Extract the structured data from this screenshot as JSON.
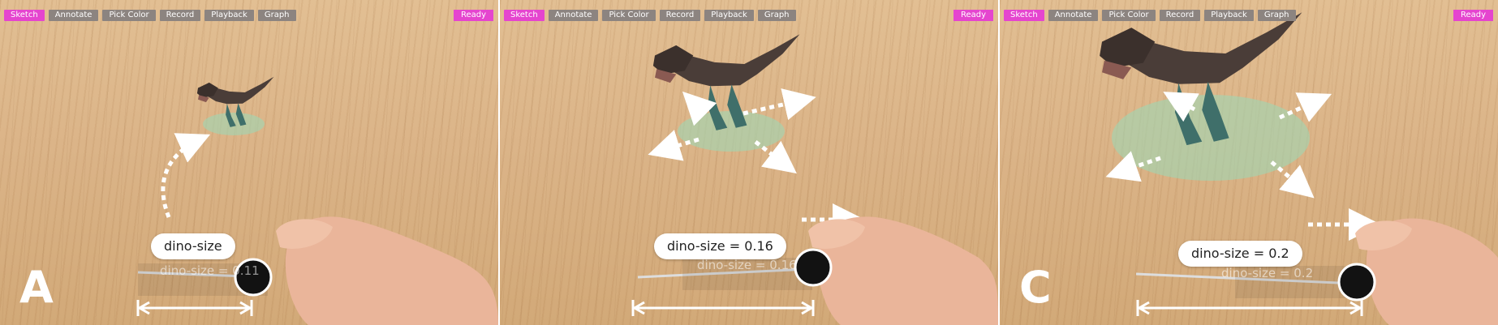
{
  "toolbar": {
    "buttons": [
      "Sketch",
      "Annotate",
      "Pick Color",
      "Record",
      "Playback",
      "Graph"
    ],
    "active": "Sketch",
    "status": "Ready"
  },
  "colors": {
    "accent": "#e545cf",
    "button": "#8c8480",
    "table": "#dbb488",
    "shadow_circle": "#9fd7b4"
  },
  "panels": [
    {
      "label": "A",
      "pill": "dino-size",
      "ghost": "dino-size = 0.11"
    },
    {
      "label": "",
      "pill": "dino-size = 0.16",
      "ghost": "dino-size = 0.16"
    },
    {
      "label": "C",
      "pill": "dino-size = 0.2",
      "ghost": "dino-size = 0.2"
    }
  ]
}
